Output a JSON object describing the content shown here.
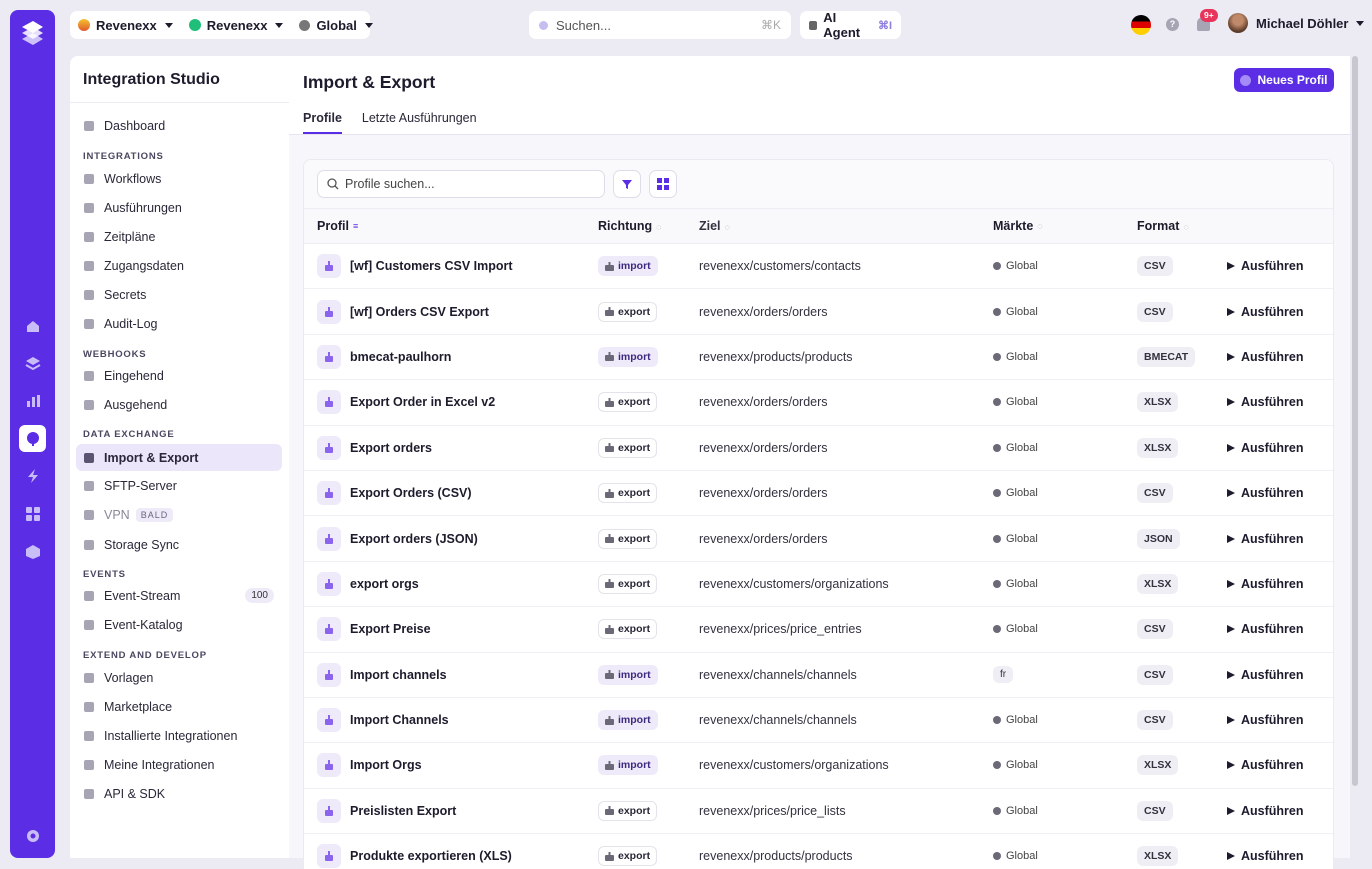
{
  "topbar": {
    "org": "Revenexx",
    "workspace": "Revenexx",
    "region": "Global",
    "search_placeholder": "Suchen...",
    "search_shortcut": "⌘K",
    "ai_label": "AI Agent",
    "ai_shortcut": "⌘I",
    "notifications_badge": "9+",
    "user_name": "Michael Döhler"
  },
  "sidebar": {
    "title": "Integration Studio",
    "dashboard": "Dashboard",
    "sections": {
      "integrations": "INTEGRATIONS",
      "webhooks": "WEBHOOKS",
      "data_exchange": "DATA EXCHANGE",
      "events": "EVENTS",
      "extend": "EXTEND AND DEVELOP"
    },
    "items": {
      "workflows": "Workflows",
      "ausfuehrungen": "Ausführungen",
      "zeitplaene": "Zeitpläne",
      "zugangsdaten": "Zugangsdaten",
      "secrets": "Secrets",
      "audit": "Audit-Log",
      "eingehend": "Eingehend",
      "ausgehend": "Ausgehend",
      "import_export": "Import & Export",
      "sftp": "SFTP-Server",
      "vpn": "VPN",
      "vpn_tag": "BALD",
      "storage": "Storage Sync",
      "event_stream": "Event-Stream",
      "event_stream_count": "100",
      "event_katalog": "Event-Katalog",
      "vorlagen": "Vorlagen",
      "marketplace": "Marketplace",
      "installiert": "Installierte Integrationen",
      "meine": "Meine Integrationen",
      "api": "API & SDK"
    }
  },
  "main": {
    "title": "Import & Export",
    "new_button": "Neues Profil",
    "tabs": [
      "Profile",
      "Letzte Ausführungen"
    ],
    "search_placeholder": "Profile suchen...",
    "columns": {
      "profil": "Profil",
      "richtung": "Richtung",
      "ziel": "Ziel",
      "maerkte": "Märkte",
      "format": "Format"
    },
    "run_label": "Ausführen"
  },
  "rows": [
    {
      "name": "[wf] Customers CSV Import",
      "dir": "import",
      "target": "revenexx/customers/contacts",
      "market": "Global",
      "format": "CSV"
    },
    {
      "name": "[wf] Orders CSV Export",
      "dir": "export",
      "target": "revenexx/orders/orders",
      "market": "Global",
      "format": "CSV"
    },
    {
      "name": "bmecat-paulhorn",
      "dir": "import",
      "target": "revenexx/products/products",
      "market": "Global",
      "format": "BMECAT"
    },
    {
      "name": "Export Order in Excel v2",
      "dir": "export",
      "target": "revenexx/orders/orders",
      "market": "Global",
      "format": "XLSX"
    },
    {
      "name": "Export orders",
      "dir": "export",
      "target": "revenexx/orders/orders",
      "market": "Global",
      "format": "XLSX"
    },
    {
      "name": "Export Orders (CSV)",
      "dir": "export",
      "target": "revenexx/orders/orders",
      "market": "Global",
      "format": "CSV"
    },
    {
      "name": "Export orders (JSON)",
      "dir": "export",
      "target": "revenexx/orders/orders",
      "market": "Global",
      "format": "JSON"
    },
    {
      "name": "export orgs",
      "dir": "export",
      "target": "revenexx/customers/organizations",
      "market": "Global",
      "format": "XLSX"
    },
    {
      "name": "Export Preise",
      "dir": "export",
      "target": "revenexx/prices/price_entries",
      "market": "Global",
      "format": "CSV"
    },
    {
      "name": "Import channels",
      "dir": "import",
      "target": "revenexx/channels/channels",
      "market": "fr",
      "format": "CSV"
    },
    {
      "name": "Import Channels",
      "dir": "import",
      "target": "revenexx/channels/channels",
      "market": "Global",
      "format": "CSV"
    },
    {
      "name": "Import Orgs",
      "dir": "import",
      "target": "revenexx/customers/organizations",
      "market": "Global",
      "format": "XLSX"
    },
    {
      "name": "Preislisten Export",
      "dir": "export",
      "target": "revenexx/prices/price_lists",
      "market": "Global",
      "format": "CSV"
    },
    {
      "name": "Produkte exportieren (XLS)",
      "dir": "export",
      "target": "revenexx/products/products",
      "market": "Global",
      "format": "XLSX"
    }
  ]
}
